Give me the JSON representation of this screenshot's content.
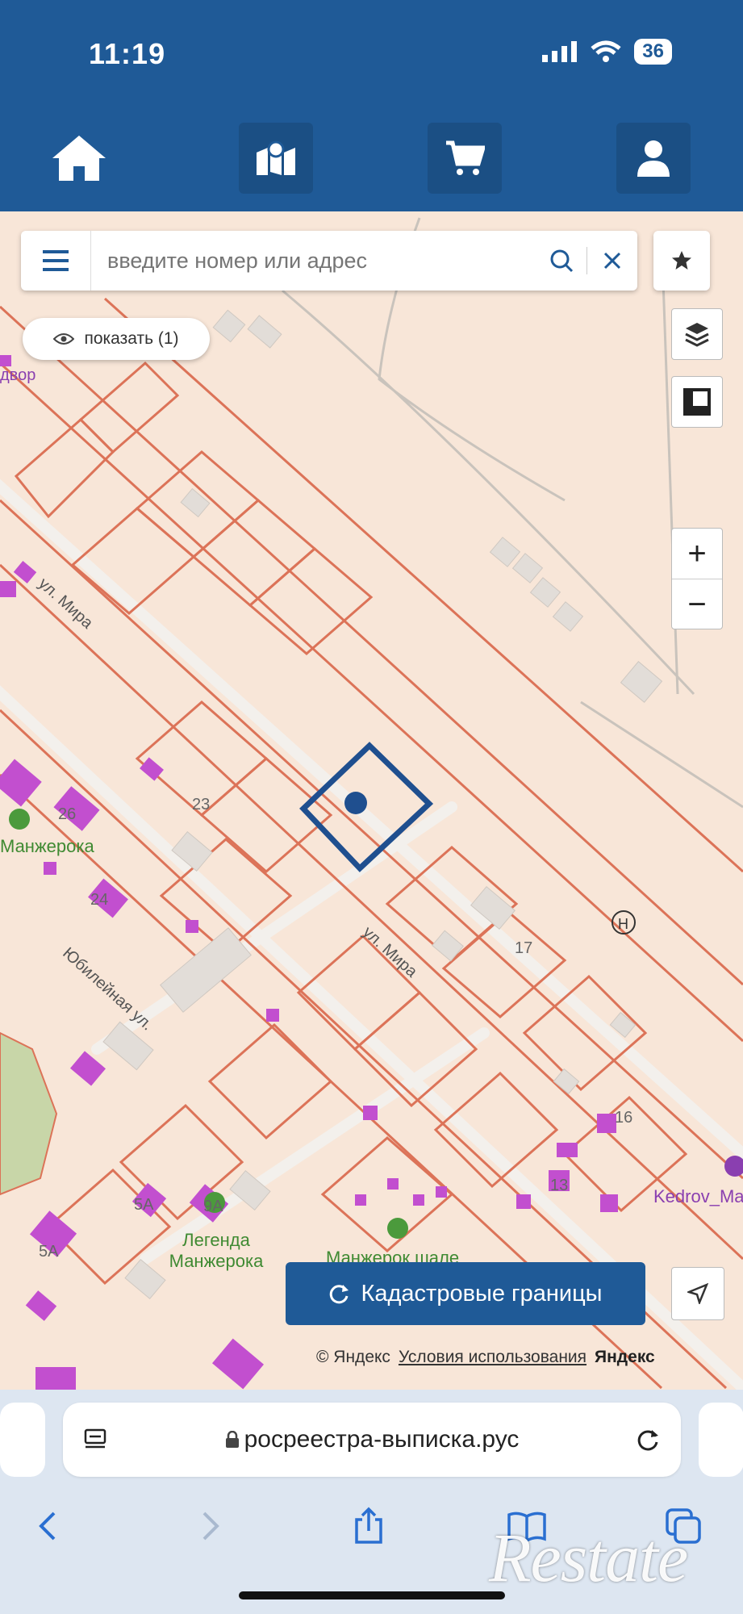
{
  "status_bar": {
    "time": "11:19",
    "battery": "36"
  },
  "nav": {
    "items": [
      "home-icon",
      "map-pin-icon",
      "cart-icon",
      "user-icon"
    ]
  },
  "search": {
    "placeholder": "введите номер или адрес"
  },
  "show_button": {
    "label": "показать (1)"
  },
  "map": {
    "street_labels": [
      "ул. Мира",
      "ул. Мира",
      "Юбилейная ул."
    ],
    "house_numbers": [
      "23",
      "26",
      "24",
      "17",
      "16",
      "13",
      "5А",
      "5А",
      "9А"
    ],
    "poi": [
      "Манжерока",
      "Легенда Манжерока",
      "Манжерок шале",
      "Kedrov_Ma",
      "двор"
    ],
    "cadastral_button": "Кадастровые границы",
    "copyright": "© Яндекс",
    "terms_link": "Условия использования",
    "brand": "Яндекс"
  },
  "browser": {
    "url": "росреестра-выписка.рус"
  },
  "watermark": "Restate",
  "colors": {
    "header": "#1f5a97",
    "map_bg": "#f8e6d8",
    "parcel_line": "#dc7358",
    "building": "#c24fcf",
    "selected": "#1f4f8f"
  }
}
